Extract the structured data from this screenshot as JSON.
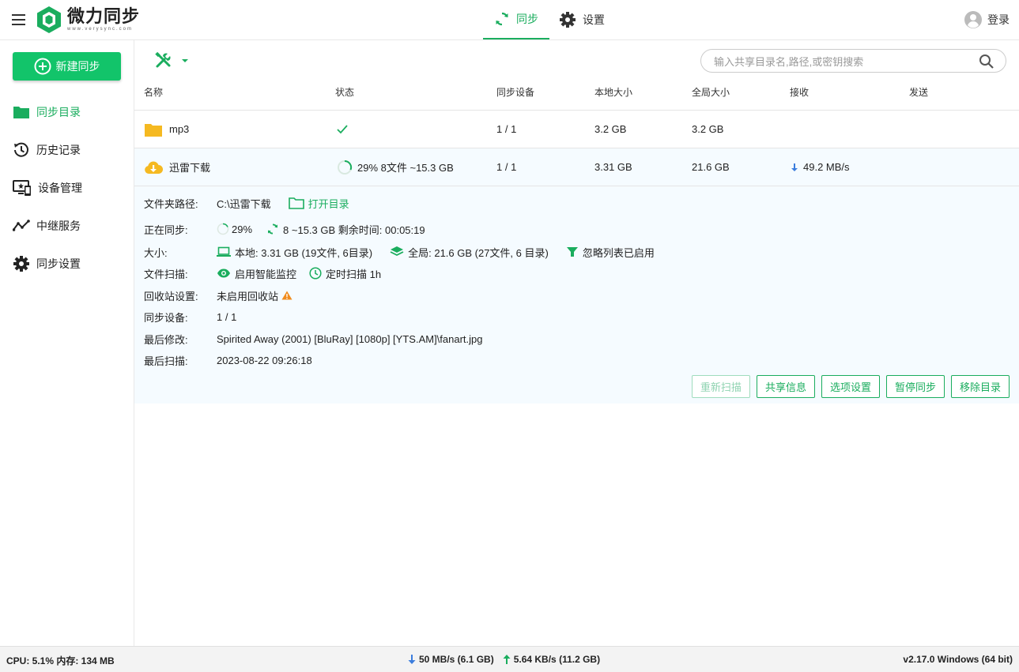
{
  "app": {
    "title": "微力同步",
    "subtitle": "www.verysync.com"
  },
  "nav": {
    "sync_label": "同步",
    "settings_label": "设置",
    "login_label": "登录"
  },
  "sidebar": {
    "new_button": "新建同步",
    "items": [
      {
        "label": "同步目录",
        "icon": "folder-icon",
        "active": true
      },
      {
        "label": "历史记录",
        "icon": "history-icon",
        "active": false
      },
      {
        "label": "设备管理",
        "icon": "device-icon",
        "active": false
      },
      {
        "label": "中继服务",
        "icon": "relay-icon",
        "active": false
      },
      {
        "label": "同步设置",
        "icon": "gear-icon",
        "active": false
      }
    ]
  },
  "search": {
    "placeholder": "输入共享目录名,路径,或密钥搜索"
  },
  "table": {
    "headers": [
      "名称",
      "状态",
      "同步设备",
      "本地大小",
      "全局大小",
      "接收",
      "发送"
    ],
    "rows": [
      {
        "name": "mp3",
        "status": "",
        "devices": "1 / 1",
        "local": "3.2 GB",
        "global": "3.2 GB",
        "recv": "",
        "send": ""
      },
      {
        "name": "迅雷下载",
        "status": "29% 8文件 ~15.3 GB",
        "devices": "1 / 1",
        "local": "3.31 GB",
        "global": "21.6 GB",
        "recv": "49.2 MB/s",
        "send": ""
      }
    ]
  },
  "detail": {
    "path_label": "文件夹路径:",
    "path_value": "C:\\迅雷下载",
    "open_dir": "打开目录",
    "syncing_label": "正在同步:",
    "sync_percent": "29%",
    "sync_progress": 0.29,
    "sync_info": "8 ~15.3 GB 剩余时间: 00:05:19",
    "size_label": "大小:",
    "local_size": "本地: 3.31 GB (19文件, 6目录)",
    "global_size": "全局: 21.6 GB (27文件, 6 目录)",
    "ignore": "忽略列表已启用",
    "scan_label": "文件扫描:",
    "smart_monitor": "启用智能监控",
    "timed_scan": "定时扫描 1h",
    "recycle_label": "回收站设置:",
    "recycle_value": "未启用回收站",
    "devices_label": "同步设备:",
    "devices_value": "1 / 1",
    "modified_label": "最后修改:",
    "modified_value": "Spirited Away (2001) [BluRay] [1080p] [YTS.AM]\\fanart.jpg",
    "scanned_label": "最后扫描:",
    "scanned_value": "2023-08-22 09:26:18"
  },
  "actions": [
    "重新扫描",
    "共享信息",
    "选项设置",
    "暂停同步",
    "移除目录"
  ],
  "status": {
    "cpu_mem": "CPU: 5.1%  内存: 134 MB",
    "down": "50 MB/s (6.1 GB)",
    "up": "5.64 KB/s (11.2 GB)",
    "version": "v2.17.0  Windows (64 bit)"
  },
  "colors": {
    "accent": "#1aad5e",
    "button": "#12c46a",
    "folder": "#f5b921",
    "warning": "#f08c1e",
    "download": "#3b7ddd"
  }
}
